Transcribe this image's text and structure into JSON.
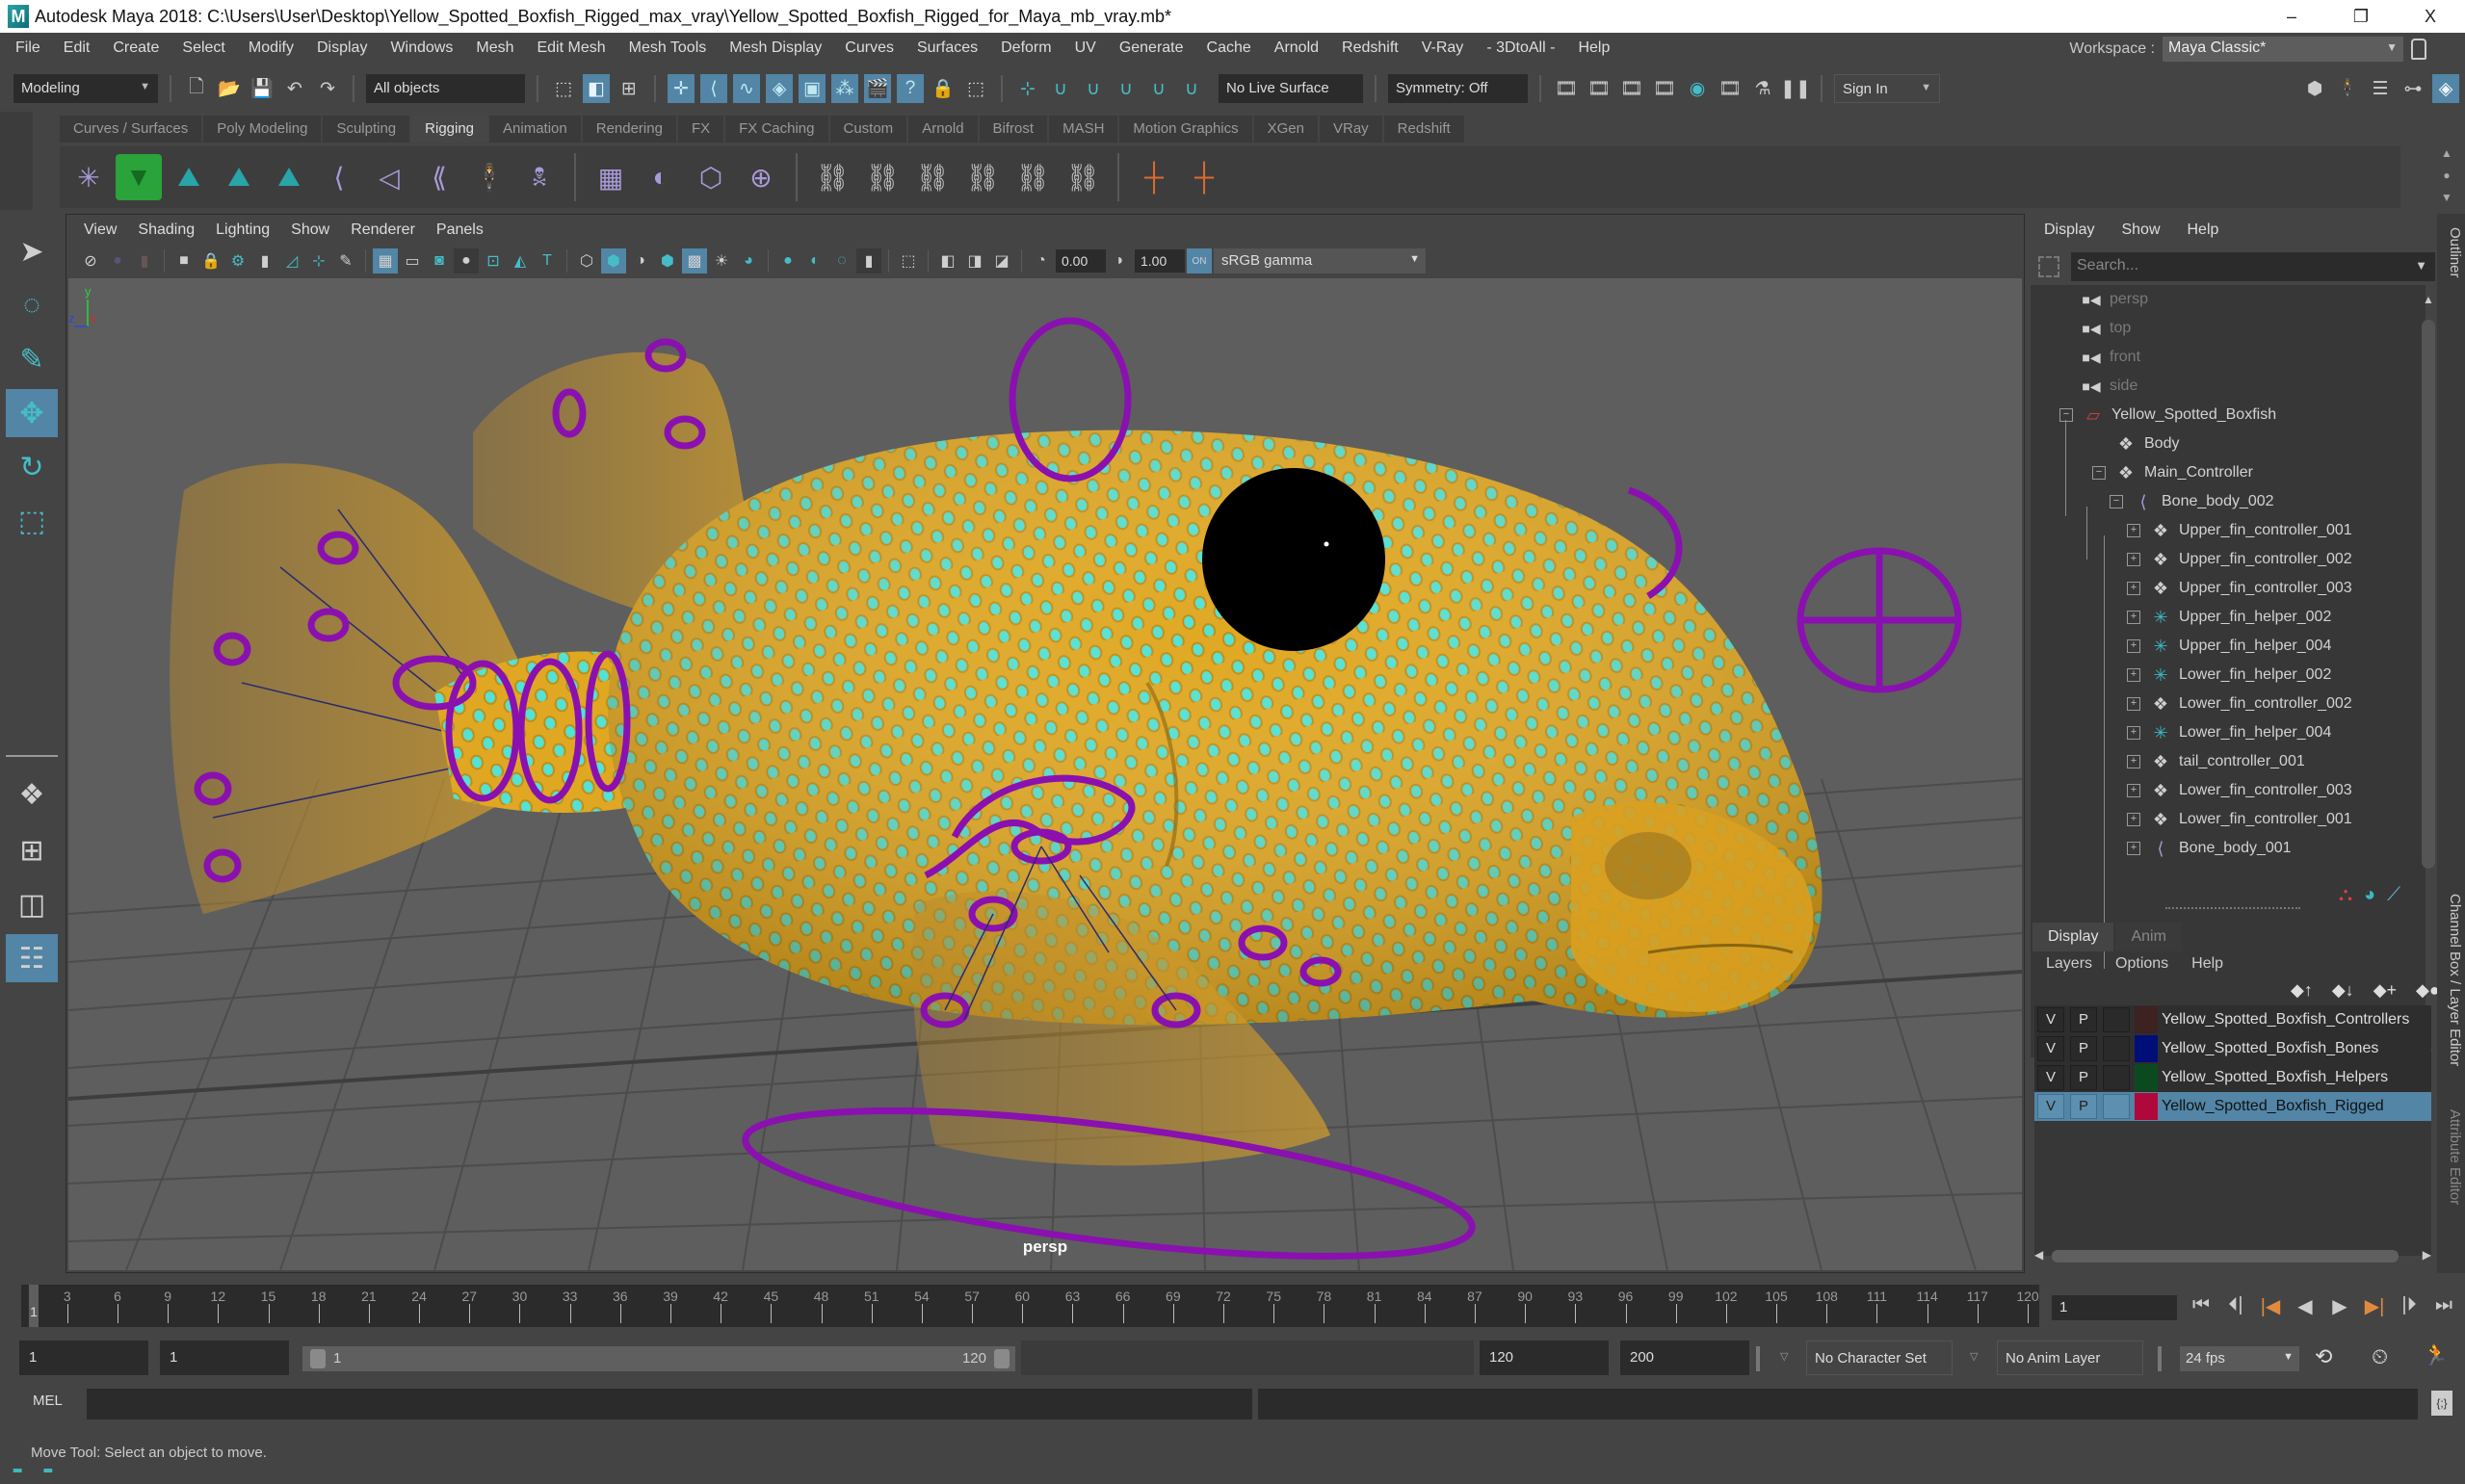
{
  "window": {
    "title": "Autodesk Maya 2018: C:\\Users\\User\\Desktop\\Yellow_Spotted_Boxfish_Rigged_max_vray\\Yellow_Spotted_Boxfish_Rigged_for_Maya_mb_vray.mb*",
    "minimize": "–",
    "restore": "❐",
    "close": "X"
  },
  "menubar": [
    "File",
    "Edit",
    "Create",
    "Select",
    "Modify",
    "Display",
    "Windows",
    "Mesh",
    "Edit Mesh",
    "Mesh Tools",
    "Mesh Display",
    "Curves",
    "Surfaces",
    "Deform",
    "UV",
    "Generate",
    "Cache",
    "Arnold",
    "Redshift",
    "V-Ray",
    "- 3DtoAll -",
    "Help"
  ],
  "workspace": {
    "label": "Workspace :",
    "value": "Maya Classic*"
  },
  "statusline": {
    "mode": "Modeling",
    "selection_mask": "All objects",
    "live_surface": "No Live Surface",
    "symmetry": "Symmetry: Off",
    "sign_in": "Sign In"
  },
  "shelf": {
    "tabs": [
      "Curves / Surfaces",
      "Poly Modeling",
      "Sculpting",
      "Rigging",
      "Animation",
      "Rendering",
      "FX",
      "FX Caching",
      "Custom",
      "Arnold",
      "Bifrost",
      "MASH",
      "Motion Graphics",
      "XGen",
      "VRay",
      "Redshift"
    ],
    "active_tab": "Rigging"
  },
  "viewport": {
    "menu": [
      "View",
      "Shading",
      "Lighting",
      "Show",
      "Renderer",
      "Panels"
    ],
    "exposure": "0.00",
    "gamma": "1.00",
    "color_space": "sRGB gamma",
    "camera": "persp",
    "axis_labels": {
      "x": "x",
      "y": "y",
      "z": "z"
    },
    "colors": {
      "fish_body": "#e2a81f",
      "spots": "#4fe0d6",
      "controllers": "#8a10b0",
      "background": "#5e5e5e"
    }
  },
  "outliner": {
    "menu": [
      "Display",
      "Show",
      "Help"
    ],
    "search_placeholder": "Search...",
    "items": [
      {
        "label": "persp",
        "type": "camera",
        "depth": 0
      },
      {
        "label": "top",
        "type": "camera",
        "depth": 0
      },
      {
        "label": "front",
        "type": "camera",
        "depth": 0
      },
      {
        "label": "side",
        "type": "camera",
        "depth": 0
      },
      {
        "label": "Yellow_Spotted_Boxfish",
        "type": "set",
        "depth": 0,
        "expanded": true
      },
      {
        "label": "Body",
        "type": "mesh",
        "depth": 1
      },
      {
        "label": "Main_Controller",
        "type": "transform",
        "depth": 1,
        "expanded": true
      },
      {
        "label": "Bone_body_002",
        "type": "joint",
        "depth": 2,
        "expanded": true
      },
      {
        "label": "Upper_fin_controller_001",
        "type": "transform",
        "depth": 3
      },
      {
        "label": "Upper_fin_controller_002",
        "type": "transform",
        "depth": 3
      },
      {
        "label": "Upper_fin_controller_003",
        "type": "transform",
        "depth": 3
      },
      {
        "label": "Upper_fin_helper_002",
        "type": "locator",
        "depth": 3
      },
      {
        "label": "Upper_fin_helper_004",
        "type": "locator",
        "depth": 3
      },
      {
        "label": "Lower_fin_helper_002",
        "type": "locator",
        "depth": 3
      },
      {
        "label": "Lower_fin_controller_002",
        "type": "transform",
        "depth": 3
      },
      {
        "label": "Lower_fin_helper_004",
        "type": "locator",
        "depth": 3
      },
      {
        "label": "tail_controller_001",
        "type": "transform",
        "depth": 3
      },
      {
        "label": "Lower_fin_controller_003",
        "type": "transform",
        "depth": 3
      },
      {
        "label": "Lower_fin_controller_001",
        "type": "transform",
        "depth": 3
      },
      {
        "label": "Bone_body_001",
        "type": "joint",
        "depth": 3
      }
    ]
  },
  "layer_editor": {
    "tabs": [
      "Display",
      "Anim"
    ],
    "active_tab": "Display",
    "menu": [
      "Layers",
      "Options",
      "Help"
    ],
    "layers": [
      {
        "v": "V",
        "p": "P",
        "color": "#3d2222",
        "name": "Yellow_Spotted_Boxfish_Controllers",
        "selected": false
      },
      {
        "v": "V",
        "p": "P",
        "color": "#000f78",
        "name": "Yellow_Spotted_Boxfish_Bones",
        "selected": false
      },
      {
        "v": "V",
        "p": "P",
        "color": "#0b4a1e",
        "name": "Yellow_Spotted_Boxfish_Helpers",
        "selected": false
      },
      {
        "v": "V",
        "p": "P",
        "color": "#b0083a",
        "name": "Yellow_Spotted_Boxfish_Rigged",
        "selected": true
      }
    ]
  },
  "side_tabs": [
    "Outliner",
    "Channel Box / Layer Editor",
    "Attribute Editor"
  ],
  "timeline": {
    "start_label": "1",
    "ticks": [
      3,
      6,
      9,
      12,
      15,
      18,
      21,
      24,
      27,
      30,
      33,
      36,
      39,
      42,
      45,
      48,
      51,
      54,
      57,
      60,
      63,
      66,
      69,
      72,
      75,
      78,
      81,
      84,
      87,
      90,
      93,
      96,
      99,
      102,
      105,
      108,
      111,
      114,
      117,
      120
    ],
    "current_frame": "1"
  },
  "range": {
    "start": "1",
    "playback_start": "1",
    "slider_min": "1",
    "slider_max": "120",
    "playback_end": "120",
    "end": "200",
    "character_set": "No Character Set",
    "anim_layer": "No Anim Layer",
    "fps": "24 fps"
  },
  "command_line": {
    "label": "MEL"
  },
  "help_line": "Move Tool: Select an object to move."
}
